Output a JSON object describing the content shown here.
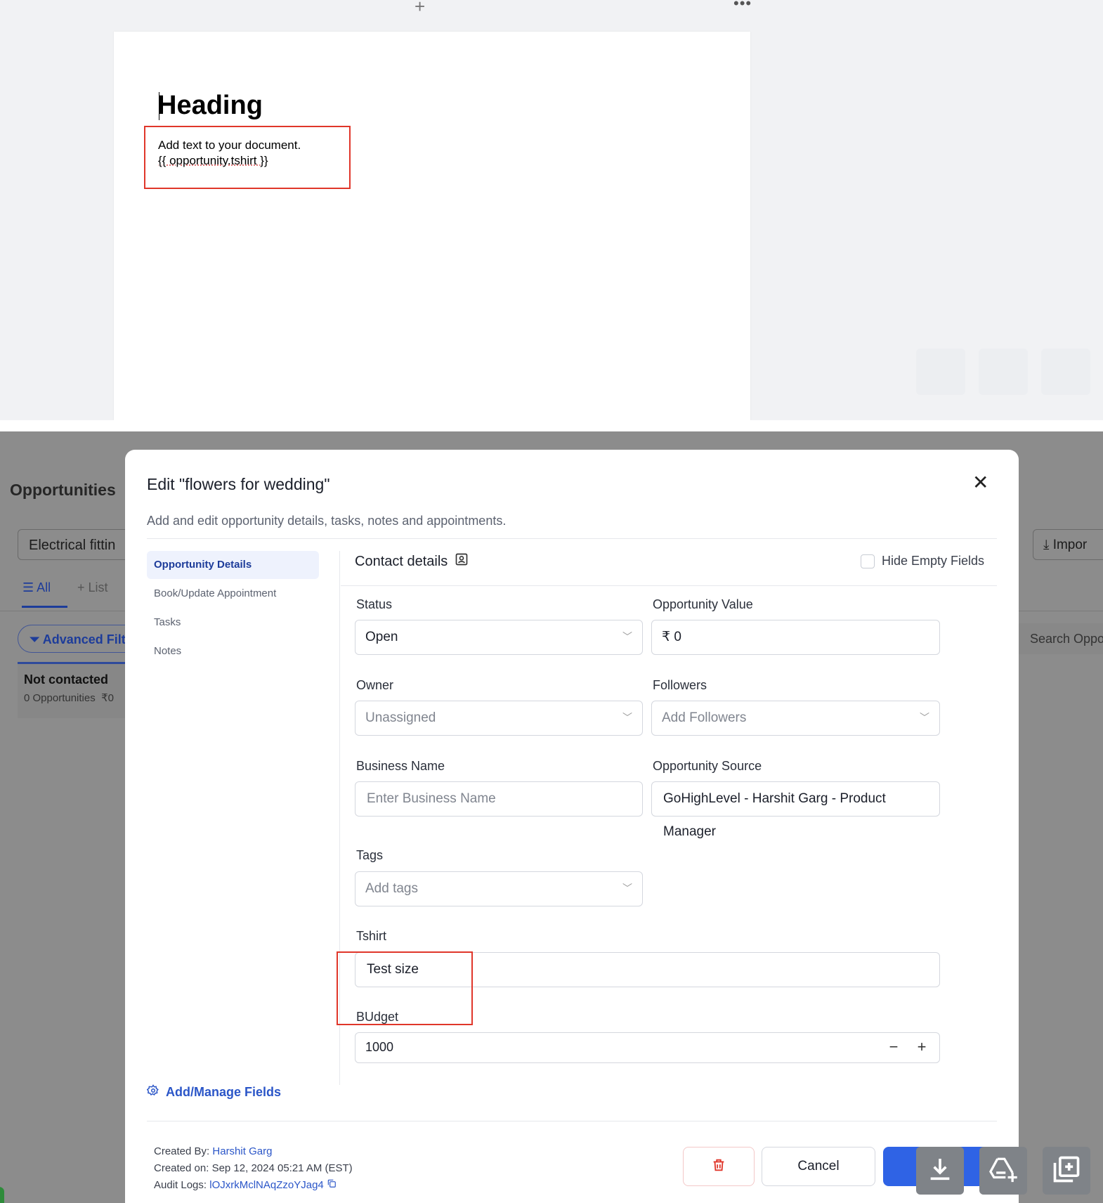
{
  "editor": {
    "heading": "Heading",
    "body_line1": "Add text to your document.",
    "body_line2": "{{ opportunity.tshirt }}",
    "add_icon": "plus-icon",
    "more_icon": "ellipsis-icon"
  },
  "background": {
    "page_title": "Opportunities",
    "pipeline_select": "Electrical fittin",
    "tab_all": "All",
    "tab_list": "List",
    "advanced_filters": "Advanced Filt",
    "stage_title": "Not contacted",
    "stage_count": "0 Opportunities",
    "stage_value": "₹0",
    "import_label": "Impor",
    "search_placeholder": "Search Oppo"
  },
  "modal": {
    "title": "Edit \"flowers for wedding\"",
    "subtitle": "Add and edit opportunity details, tasks, notes and appointments.",
    "sidebar": [
      {
        "label": "Opportunity Details",
        "active": true
      },
      {
        "label": "Book/Update Appointment",
        "active": false
      },
      {
        "label": "Tasks",
        "active": false
      },
      {
        "label": "Notes",
        "active": false
      }
    ],
    "manage_fields": "Add/Manage Fields",
    "contact_details": "Contact details",
    "hide_empty": "Hide Empty Fields",
    "fields": {
      "status_label": "Status",
      "status_value": "Open",
      "value_label": "Opportunity Value",
      "value_value": "₹ 0",
      "owner_label": "Owner",
      "owner_value": "Unassigned",
      "followers_label": "Followers",
      "followers_placeholder": "Add Followers",
      "business_label": "Business Name",
      "business_placeholder": "Enter Business Name",
      "source_label": "Opportunity Source",
      "source_value": "GoHighLevel - Harshit Garg - Product Manager",
      "tags_label": "Tags",
      "tags_placeholder": "Add tags",
      "tshirt_label": "Tshirt",
      "tshirt_value": "Test size",
      "budget_label": "BUdget",
      "budget_value": "1000"
    },
    "footer": {
      "created_by_label": "Created By:",
      "created_by": "Harshit Garg",
      "created_on_label": "Created on:",
      "created_on": "Sep 12, 2024 05:21 AM (EST)",
      "audit_label": "Audit Logs:",
      "audit_id": "lOJxrkMclNAqZzoYJag4",
      "cancel": "Cancel"
    }
  },
  "colors": {
    "accent": "#2f63e5",
    "highlight": "#e0362a",
    "link": "#2b56c8"
  }
}
